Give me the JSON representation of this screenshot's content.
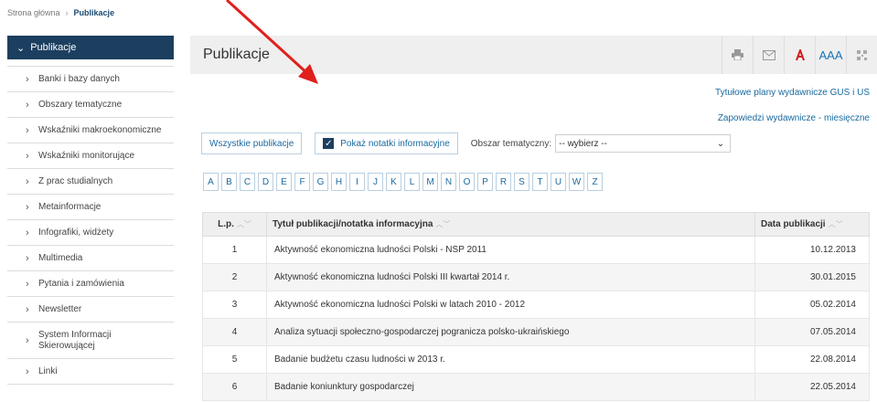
{
  "breadcrumb": {
    "home": "Strona główna",
    "current": "Publikacje"
  },
  "sidebar": {
    "active": "Publikacje",
    "items": [
      {
        "label": "Banki i bazy danych"
      },
      {
        "label": "Obszary tematyczne"
      },
      {
        "label": "Wskaźniki makroekonomiczne"
      },
      {
        "label": "Wskaźniki monitorujące"
      },
      {
        "label": "Z prac studialnych"
      },
      {
        "label": "Metainformacje"
      },
      {
        "label": "Infografiki, widżety"
      },
      {
        "label": "Multimedia"
      },
      {
        "label": "Pytania i zamówienia"
      },
      {
        "label": "Newsletter"
      },
      {
        "label": "System Informacji Skierowującej"
      },
      {
        "label": "Linki"
      }
    ]
  },
  "header": {
    "title": "Publikacje",
    "font_tool": "AAA"
  },
  "links": {
    "plans": "Tytułowe plany wydawnicze GUS i US",
    "announcements": "Zapowiedzi wydawnicze - miesięczne"
  },
  "filters": {
    "all_button": "Wszystkie publikacje",
    "notes_checkbox": "Pokaż notatki informacyjne",
    "topic_label": "Obszar tematyczny:",
    "topic_selected": "-- wybierz --"
  },
  "letters": [
    "A",
    "B",
    "C",
    "D",
    "E",
    "F",
    "G",
    "H",
    "I",
    "J",
    "K",
    "L",
    "M",
    "N",
    "O",
    "P",
    "R",
    "S",
    "T",
    "U",
    "W",
    "Z"
  ],
  "table": {
    "headers": {
      "lp": "L.p.",
      "title": "Tytuł publikacji/notatka informacyjna",
      "date": "Data publikacji"
    },
    "rows": [
      {
        "lp": "1",
        "title": "Aktywność ekonomiczna ludności Polski - NSP 2011",
        "date": "10.12.2013"
      },
      {
        "lp": "2",
        "title": "Aktywność ekonomiczna ludności Polski III kwartał 2014 r.",
        "date": "30.01.2015"
      },
      {
        "lp": "3",
        "title": "Aktywność ekonomiczna ludności Polski w latach 2010 - 2012",
        "date": "05.02.2014"
      },
      {
        "lp": "4",
        "title": "Analiza sytuacji społeczno-gospodarczej pogranicza polsko-ukraińskiego",
        "date": "07.05.2014"
      },
      {
        "lp": "5",
        "title": "Badanie budżetu czasu ludności w 2013 r.",
        "date": "22.08.2014"
      },
      {
        "lp": "6",
        "title": "Badanie koniunktury gospodarczej",
        "date": "22.05.2014"
      }
    ]
  },
  "colors": {
    "navy": "#1c3f5f",
    "link": "#1a6aa0",
    "pdf": "#d21f1f",
    "annotation_arrow": "#e0201c"
  },
  "icons": [
    "print-icon",
    "mail-icon",
    "pdf-icon",
    "font-size-icon",
    "qr-code-icon",
    "chevron-down-icon",
    "chevron-right-icon",
    "check-icon",
    "sort-icon"
  ]
}
